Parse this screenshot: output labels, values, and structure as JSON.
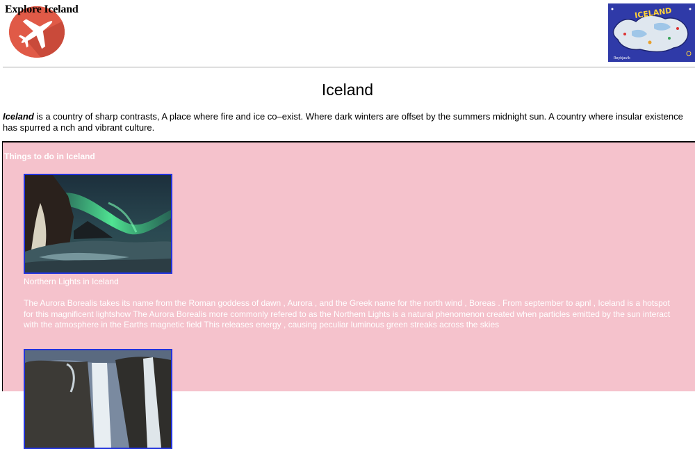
{
  "header": {
    "site_title": "Explore Iceland",
    "logo_icon": "airplane-icon",
    "map_text": "ICELAND",
    "map_caption": "Reykjavík"
  },
  "main": {
    "title": "Iceland",
    "intro_emphasis": "Iceland",
    "intro_text": " is a country of sharp contrasts, A place where fire and ice co–exist. Where dark winters are offset by the summers midnight sun. A country where insular existence has spurred a nch and vibrant culture."
  },
  "things_to_do": {
    "heading": "Things to do in Iceland",
    "items": [
      {
        "caption": "Northern Lights in Iceland",
        "description": "The Aurora Borealis takes its name from the Roman goddess of dawn , Aurora , and the Greek name for the north wind , Boreas . From september to apnl , Iceland is a hotspot for this magnificent lightshow The Aurora Borealis more commonly refered to as the Northem Lights is a natural phenomenon created when particles emitted by the sun interact with the atmosphere in the Earths magnetic field This releases energy , causing peculiar luminous green streaks across the skies"
      }
    ]
  },
  "colors": {
    "section_background": "#f5c2cc",
    "logo_red": "#e05a47",
    "photo_border": "#2233dd"
  }
}
